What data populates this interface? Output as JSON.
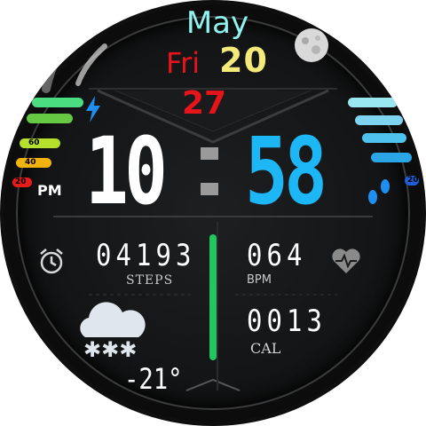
{
  "date": {
    "month": "May",
    "day_name": "Fri",
    "day_number": "20",
    "week_number": "27"
  },
  "time": {
    "hours": "10",
    "minutes": "58",
    "ampm": "PM"
  },
  "battery_scale": {
    "labels": [
      "60",
      "40",
      "20"
    ]
  },
  "step_goal_scale": {
    "label": "20"
  },
  "steps": {
    "value": "04193",
    "label": "STEPS"
  },
  "heart_rate": {
    "value": "064",
    "label": "BPM"
  },
  "calories": {
    "value": "0013",
    "label": "CAL"
  },
  "weather": {
    "temperature": "-21°",
    "condition_icon": "snow-cloud-icon"
  },
  "icons": [
    "moon-phase-icon",
    "lightning-icon",
    "footsteps-icon",
    "alarm-icon",
    "heart-icon",
    "snow-cloud-icon"
  ],
  "colors": {
    "hours": "#ffffff",
    "minutes": "#1eb7f6",
    "month": "#8ff3f0",
    "day_name": "#e8141c",
    "day_number": "#f3ea7a",
    "week_number": "#e8141c",
    "accent_green": "#22c55e"
  }
}
